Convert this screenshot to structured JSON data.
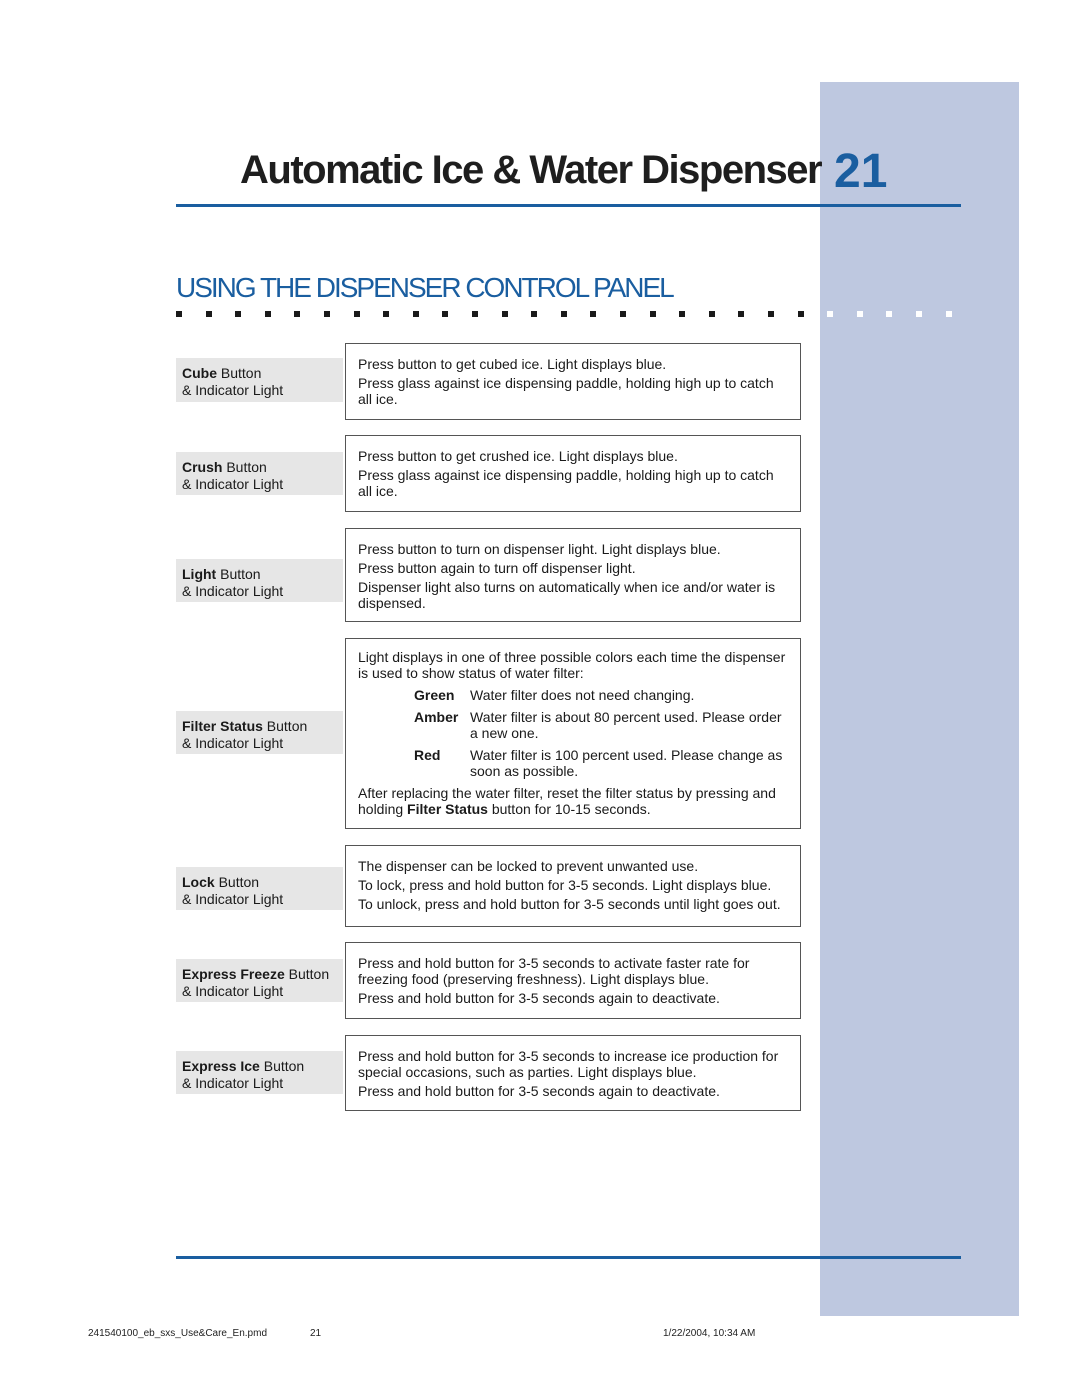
{
  "header": {
    "title": "Automatic Ice & Water Dispenser",
    "page_number": "21"
  },
  "section_title": "USING THE DISPENSER CONTROL PANEL",
  "colors": {
    "accent": "#1a5ea0",
    "sidebar": "#bec8e0",
    "label_bg": "#e6e6e6"
  },
  "rows": [
    {
      "name_bold": "Cube",
      "name_rest": " Button",
      "sub": "& Indicator Light",
      "lines": [
        "Press button to get cubed ice. Light displays blue.",
        "Press glass against ice dispensing paddle, holding high up to catch all ice."
      ]
    },
    {
      "name_bold": "Crush",
      "name_rest": " Button",
      "sub": "& Indicator Light",
      "lines": [
        "Press button to get crushed ice. Light displays blue.",
        "Press glass against ice dispensing paddle, holding high up to catch all ice."
      ]
    },
    {
      "name_bold": "Light",
      "name_rest": " Button",
      "sub": "& Indicator Light",
      "lines": [
        "Press button to turn on dispenser light. Light displays blue.",
        "Press button again to turn off dispenser light.",
        "Dispenser light also turns on automatically when ice and/or water is dispensed."
      ]
    },
    {
      "name_bold": "Filter Status",
      "name_rest": " Button",
      "sub": "& Indicator Light",
      "intro": "Light displays in one of three possible colors each time the dispenser is used to show status of water filter:",
      "statuses": [
        {
          "color": "Green",
          "text": "Water filter does not need changing."
        },
        {
          "color": "Amber",
          "text": "Water filter is about 80 percent used. Please order a new one."
        },
        {
          "color": "Red",
          "text": "Water filter is 100 percent used. Please change as soon as possible."
        }
      ],
      "outro_a": "After replacing the water filter, reset the filter status by pressing and holding ",
      "outro_bold": "Filter Status",
      "outro_b": " button for 10-15 seconds."
    },
    {
      "name_bold": "Lock",
      "name_rest": " Button",
      "sub": "& Indicator Light",
      "lines": [
        "The dispenser can be locked to prevent unwanted use.",
        "To lock, press and hold button for 3-5 seconds. Light displays blue.",
        "To unlock, press and hold button for 3-5 seconds until light goes out."
      ]
    },
    {
      "name_bold": "Express Freeze",
      "name_rest": " Button",
      "sub": "& Indicator Light",
      "lines": [
        "Press and hold button for 3-5 seconds to activate faster rate for freezing food (preserving freshness). Light displays blue.",
        "Press and hold button for 3-5 seconds again to deactivate."
      ]
    },
    {
      "name_bold": "Express Ice",
      "name_rest": " Button",
      "sub": "& Indicator Light",
      "lines": [
        "Press and hold button for 3-5 seconds to increase ice production for special occasions, such as parties. Light displays blue.",
        "Press and hold button for 3-5 seconds again to deactivate."
      ]
    }
  ],
  "footer": {
    "file": "241540100_eb_sxs_Use&Care_En.pmd",
    "page": "21",
    "timestamp": "1/22/2004, 10:34 AM"
  }
}
